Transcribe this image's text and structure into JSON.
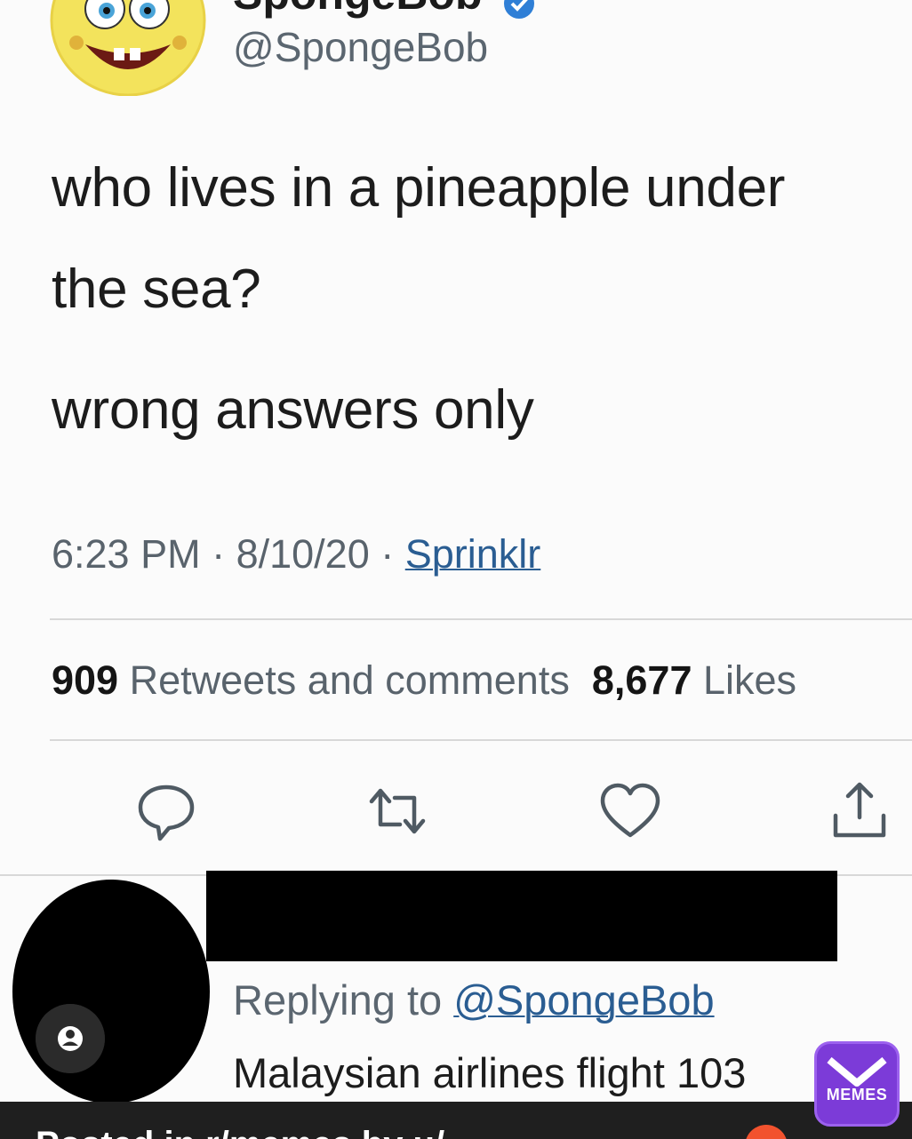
{
  "author": {
    "display_name": "SpongeBob",
    "handle": "@SpongeBob",
    "verified": true
  },
  "tweet": {
    "text_line1": "who lives in a pineapple under",
    "text_line2": "the sea?",
    "text_line3": "wrong answers only",
    "time": "6:23 PM",
    "date": "8/10/20",
    "source": "Sprinklr",
    "separator": " · "
  },
  "stats": {
    "retweets_count": "909",
    "retweets_label": "Retweets and comments",
    "likes_count": "8,677",
    "likes_label": "Likes"
  },
  "actions": [
    {
      "name": "reply",
      "icon": "comment-icon"
    },
    {
      "name": "retweet",
      "icon": "retweet-icon"
    },
    {
      "name": "like",
      "icon": "heart-icon"
    },
    {
      "name": "share",
      "icon": "share-icon"
    }
  ],
  "reply": {
    "replying_prefix": "Replying to ",
    "replying_to": "@SpongeBob",
    "text": "Malaysian airlines flight 103"
  },
  "watermark": {
    "bottom_text": "Posted in r/memes by u/...",
    "logo_text": "MEMES"
  },
  "colors": {
    "link": "#2a5d92",
    "secondary_text": "#5b6670",
    "logo_purple": "#7c3bd8"
  }
}
